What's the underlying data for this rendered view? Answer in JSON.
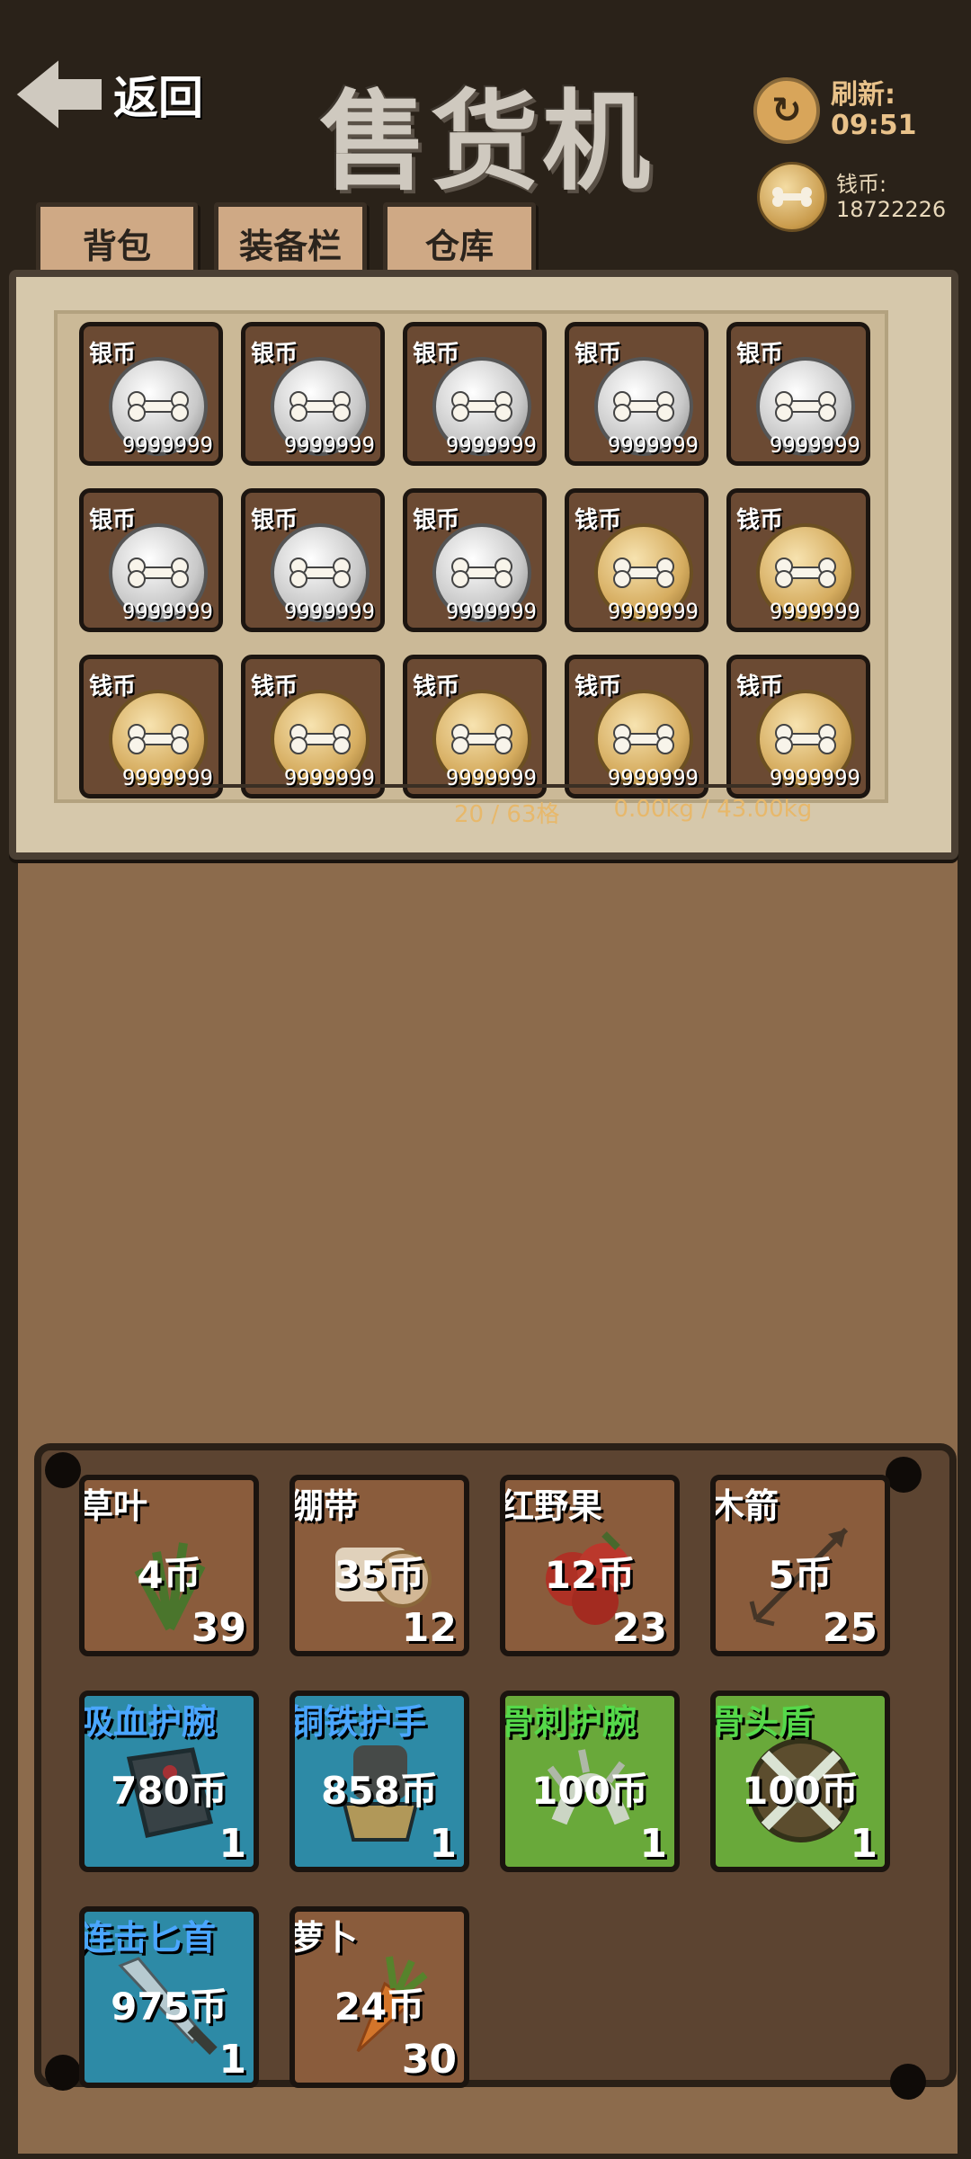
{
  "header": {
    "back_label": "返回",
    "title": "售货机",
    "refresh_label": "刷新:",
    "refresh_time": "09:51",
    "money_label": "钱币:",
    "money_value": "18722226"
  },
  "tabs": [
    {
      "label": "背包"
    },
    {
      "label": "装备栏"
    },
    {
      "label": "仓库"
    }
  ],
  "inventory": {
    "slots": [
      {
        "name": "银币",
        "qty": "9999999",
        "type": "silver"
      },
      {
        "name": "银币",
        "qty": "9999999",
        "type": "silver"
      },
      {
        "name": "银币",
        "qty": "9999999",
        "type": "silver"
      },
      {
        "name": "银币",
        "qty": "9999999",
        "type": "silver"
      },
      {
        "name": "银币",
        "qty": "9999999",
        "type": "silver"
      },
      {
        "name": "银币",
        "qty": "9999999",
        "type": "silver"
      },
      {
        "name": "银币",
        "qty": "9999999",
        "type": "silver"
      },
      {
        "name": "银币",
        "qty": "9999999",
        "type": "silver"
      },
      {
        "name": "钱币",
        "qty": "9999999",
        "type": "gold"
      },
      {
        "name": "钱币",
        "qty": "9999999",
        "type": "gold"
      },
      {
        "name": "钱币",
        "qty": "9999999",
        "type": "gold"
      },
      {
        "name": "钱币",
        "qty": "9999999",
        "type": "gold"
      },
      {
        "name": "钱币",
        "qty": "9999999",
        "type": "gold"
      },
      {
        "name": "钱币",
        "qty": "9999999",
        "type": "gold"
      },
      {
        "name": "钱币",
        "qty": "9999999",
        "type": "gold"
      }
    ],
    "capacity": "20 / 63格",
    "weight": "0.00kg / 43.00kg"
  },
  "shop": {
    "items": [
      {
        "name": "草叶",
        "price": "4币",
        "stock": "39",
        "rarity": "common",
        "icon": "grass-icon"
      },
      {
        "name": "绷带",
        "price": "35币",
        "stock": "12",
        "rarity": "common",
        "icon": "bandage-icon"
      },
      {
        "name": "红野果",
        "price": "12币",
        "stock": "23",
        "rarity": "common",
        "icon": "berry-icon"
      },
      {
        "name": "木箭",
        "price": "5币",
        "stock": "25",
        "rarity": "common",
        "icon": "arrow-icon"
      },
      {
        "name": "吸血护腕",
        "price": "780币",
        "stock": "1",
        "rarity": "blue",
        "icon": "bracer-icon"
      },
      {
        "name": "铜铁护手",
        "price": "858币",
        "stock": "1",
        "rarity": "blue",
        "icon": "gauntlet-icon"
      },
      {
        "name": "骨刺护腕",
        "price": "100币",
        "stock": "1",
        "rarity": "green",
        "icon": "bone-bracer-icon"
      },
      {
        "name": "骨头盾",
        "price": "100币",
        "stock": "1",
        "rarity": "green",
        "icon": "bone-shield-icon"
      },
      {
        "name": "连击匕首",
        "price": "975币",
        "stock": "1",
        "rarity": "blue",
        "icon": "dagger-icon"
      },
      {
        "name": "萝卜",
        "price": "24币",
        "stock": "30",
        "rarity": "common",
        "icon": "carrot-icon"
      }
    ]
  },
  "colors": {
    "blue_rarity": "#2d8aa6",
    "green_rarity": "#69a93a",
    "slot_bg": "#6b4a33"
  }
}
